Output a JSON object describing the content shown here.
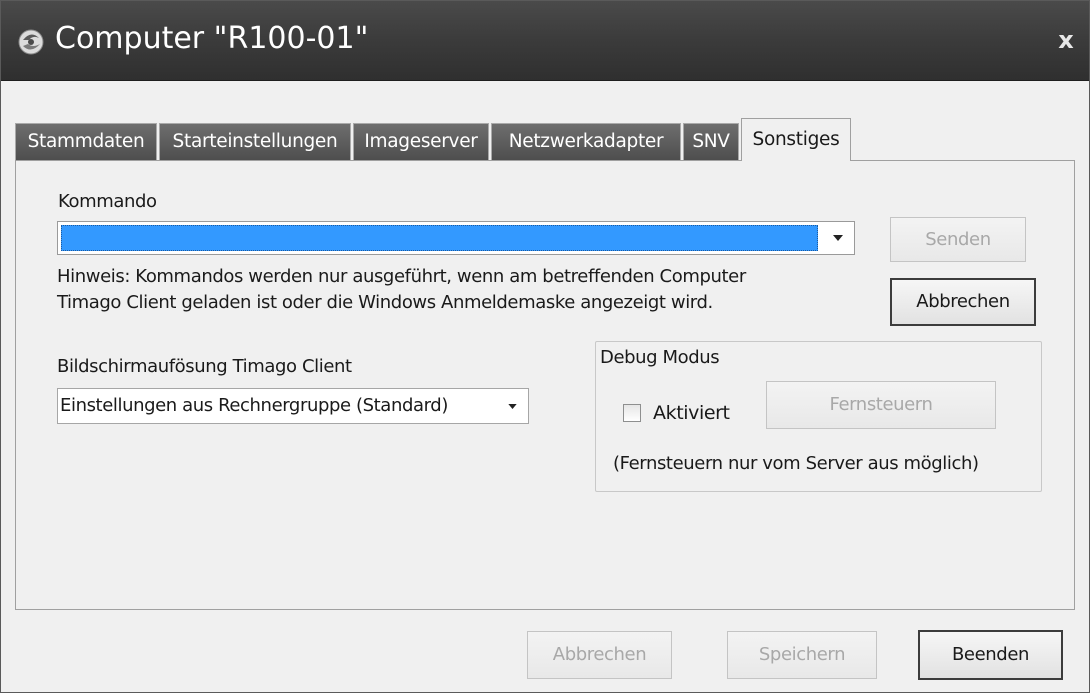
{
  "window": {
    "title": "Computer \"R100-01\"",
    "close_glyph": "x"
  },
  "tabs": [
    {
      "label": "Stammdaten",
      "active": false
    },
    {
      "label": "Starteinstellungen",
      "active": false
    },
    {
      "label": "Imageserver",
      "active": false
    },
    {
      "label": "Netzwerkadapter",
      "active": false
    },
    {
      "label": "SNV",
      "active": false
    },
    {
      "label": "Sonstiges",
      "active": true
    }
  ],
  "command": {
    "label": "Kommando",
    "value": "",
    "send_label": "Senden",
    "cancel_label": "Abbrechen",
    "hint_line1": "Hinweis: Kommandos werden nur ausgeführt,  wenn am betreffenden Computer",
    "hint_line2": "Timago Client geladen ist oder die Windows Anmeldemaske angezeigt wird."
  },
  "resolution": {
    "label": "Bildschirmaufösung Timago Client",
    "value": "Einstellungen aus Rechnergruppe (Standard)"
  },
  "debug": {
    "group_label": "Debug Modus",
    "checkbox_label": "Aktiviert",
    "checked": false,
    "remote_button": "Fernsteuern",
    "remote_note": "(Fernsteuern nur vom Server aus möglich)"
  },
  "footer": {
    "cancel_label": "Abbrechen",
    "save_label": "Speichern",
    "close_label": "Beenden"
  },
  "icons": {
    "app": "app-logo-icon",
    "dropdown": "chevron-down-icon",
    "close": "close-icon"
  },
  "colors": {
    "titlebar": "#3b3b3b",
    "selection": "#3399ff",
    "window_bg": "#f0f0f0"
  }
}
